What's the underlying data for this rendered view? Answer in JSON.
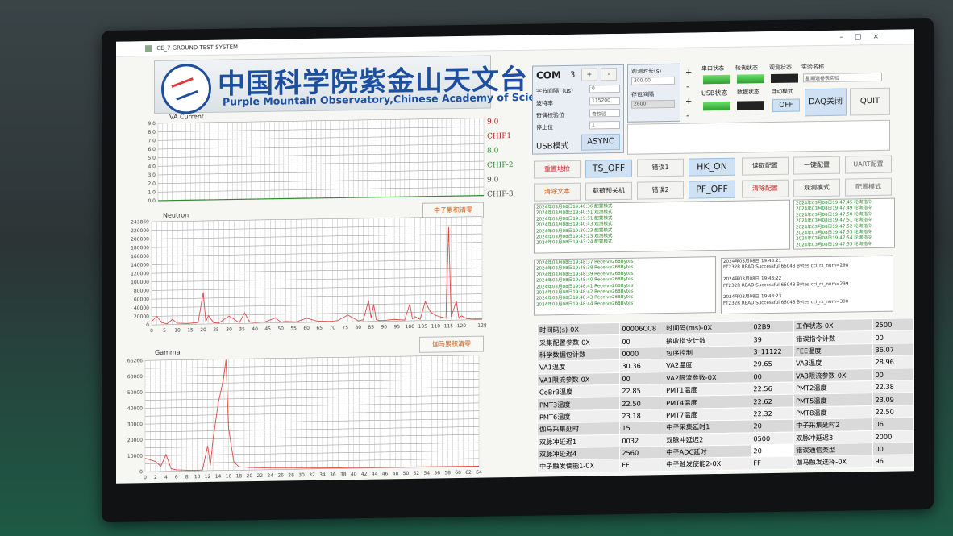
{
  "window": {
    "title": "CE_7 GROUND TEST SYSTEM"
  },
  "header": {
    "cn": "中国科学院紫金山天文台",
    "en": "Purple Mountain Observatory,Chinese Academy of Sciences"
  },
  "va_plot": {
    "label": "VA Current",
    "yticks": [
      "9.0",
      "8.0",
      "7.0",
      "6.0",
      "5.0",
      "4.0",
      "3.0",
      "2.0",
      "1.0",
      "0.0"
    ]
  },
  "legend": [
    {
      "value": "9.0",
      "color": "#c0281e"
    },
    {
      "name": "CHIP1",
      "color": "#c0281e"
    },
    {
      "value": "8.0",
      "color": "#2f8a2f"
    },
    {
      "name": "CHIP-2",
      "color": "#2f8a2f"
    },
    {
      "value": "9.0",
      "color": "#555555"
    },
    {
      "name": "CHIP-3",
      "color": "#555555"
    }
  ],
  "neutron_plot": {
    "label": "Neutron",
    "button": "中子累积清零",
    "yticks": [
      "243869",
      "220000",
      "200000",
      "180000",
      "160000",
      "140000",
      "120000",
      "100000",
      "80000",
      "60000",
      "40000",
      "20000",
      "0"
    ],
    "xticks": [
      "0",
      "5",
      "10",
      "15",
      "20",
      "25",
      "30",
      "35",
      "40",
      "45",
      "50",
      "55",
      "60",
      "65",
      "70",
      "75",
      "80",
      "85",
      "90",
      "95",
      "100",
      "105",
      "110",
      "115",
      "120",
      "128"
    ]
  },
  "gamma_plot": {
    "label": "Gamma",
    "button": "伽马累积清零",
    "yticks": [
      "66266",
      "60000",
      "50000",
      "40000",
      "30000",
      "20000",
      "10000",
      "0"
    ],
    "xticks": [
      "0",
      "2",
      "4",
      "6",
      "8",
      "10",
      "12",
      "14",
      "16",
      "18",
      "20",
      "22",
      "24",
      "26",
      "28",
      "30",
      "32",
      "34",
      "36",
      "38",
      "40",
      "42",
      "44",
      "46",
      "48",
      "50",
      "52",
      "54",
      "56",
      "58",
      "60",
      "62",
      "64"
    ]
  },
  "chart_data": [
    {
      "type": "line",
      "title": "VA Current",
      "series": [
        {
          "name": "CHIP1",
          "color": "#c0281e",
          "values": [
            0
          ]
        },
        {
          "name": "CHIP-2",
          "color": "#2f8a2f",
          "values": [
            0
          ]
        },
        {
          "name": "CHIP-3",
          "color": "#555555",
          "values": [
            0
          ]
        }
      ],
      "ylim": [
        0,
        9
      ]
    },
    {
      "type": "line",
      "title": "Neutron",
      "xlim": [
        0,
        128
      ],
      "ylim": [
        0,
        243869
      ],
      "x": [
        0,
        2,
        4,
        6,
        8,
        10,
        14,
        18,
        20,
        21,
        22,
        24,
        26,
        30,
        34,
        36,
        38,
        40,
        44,
        48,
        50,
        52,
        56,
        60,
        64,
        68,
        70,
        72,
        76,
        80,
        82,
        84,
        85,
        86,
        87,
        88,
        90,
        94,
        98,
        100,
        101,
        102,
        104,
        106,
        108,
        110,
        112,
        114,
        115,
        116,
        118,
        119,
        120,
        122,
        124,
        126,
        128
      ],
      "values": [
        8000,
        20000,
        5000,
        2000,
        12000,
        3000,
        2000,
        4000,
        75000,
        6000,
        20000,
        3000,
        2000,
        18000,
        2000,
        25000,
        3000,
        2000,
        3000,
        12000,
        2000,
        3000,
        2000,
        10000,
        3000,
        2000,
        2000,
        3000,
        16000,
        2000,
        4000,
        50000,
        8000,
        40000,
        4000,
        2000,
        2000,
        4000,
        2000,
        40000,
        5000,
        10000,
        3000,
        45000,
        20000,
        12000,
        8000,
        5000,
        220000,
        8000,
        45000,
        4000,
        10000,
        3000,
        2000,
        2000,
        2000
      ]
    },
    {
      "type": "line",
      "title": "Gamma",
      "xlim": [
        0,
        64
      ],
      "ylim": [
        0,
        66266
      ],
      "x": [
        0,
        1,
        2,
        3,
        4,
        5,
        6,
        8,
        10,
        11,
        12,
        12.5,
        13,
        14,
        15,
        15.5,
        16,
        17,
        18,
        20,
        24,
        28,
        32,
        36,
        40,
        44,
        48,
        52,
        56,
        60,
        64
      ],
      "values": [
        8000,
        7000,
        6000,
        3000,
        10000,
        1500,
        800,
        500,
        400,
        500,
        15000,
        3000,
        18000,
        40000,
        54000,
        66000,
        25000,
        5000,
        2000,
        1500,
        1000,
        800,
        600,
        500,
        500,
        400,
        300,
        300,
        200,
        200,
        100
      ]
    }
  ],
  "com": {
    "label": "COM",
    "port": "3",
    "plus": "+",
    "minus": "-",
    "byte_interval_label": "字节间隔（us）",
    "byte_interval_value": "0",
    "baud_label": "波特率",
    "baud_value": "115200",
    "parity_label": "奇偶校验位",
    "parity_value": "奇校验",
    "stop_label": "停止位",
    "stop_value": "1",
    "usb_mode_label": "USB模式",
    "async_label": "ASYNC"
  },
  "observe": {
    "duration_label": "观测时长(s)",
    "duration_value": "300.00",
    "interval_label": "存包间隔",
    "interval_value": "2600",
    "plus": "+",
    "minus": "-"
  },
  "status": {
    "serial_label": "串口状态",
    "polling_label": "轮询状态",
    "obs_label": "观测状态",
    "exp_label": "实验名称",
    "exp_value": "星期选卷表实验",
    "usb_label": "USB状态",
    "data_label": "数据状态",
    "auto_label": "自动模式",
    "auto_value": "OFF"
  },
  "actions": {
    "daq": "DAQ关闭",
    "quit": "QUIT"
  },
  "buttons": {
    "b1": "重置地检",
    "b2": "TS_OFF",
    "b3": "错误1",
    "b4": "HK_ON",
    "b5": "读取配置",
    "b6": "一键配置",
    "b7": "UART配置",
    "b8": "清除文本",
    "b9": "载荷预关机",
    "b10": "错误2",
    "b11": "PF_OFF",
    "b12": "清除配置",
    "b13": "观测模式",
    "b14": "配置模式"
  },
  "logs": {
    "config": [
      "2024年03月08日19:40:36  配置模式",
      "2024年03月08日19:40:51  观测模式",
      "2024年03月08日19:29:51  配置模式",
      "2024年03月08日19:40:43  观测模式",
      "2024年03月08日19:30:23  配置模式",
      "2024年03月08日19:43:23  观测模式",
      "2024年03月08日19:43:24  配置模式"
    ],
    "polling": [
      "2024年03月08日19:47:45  轮询指令",
      "2024年03月08日19:47:49  轮询指令",
      "2024年03月08日19:47:50  轮询指令",
      "2024年03月08日19:47:51  轮询指令",
      "2024年03月08日19:47:52  轮询指令",
      "2024年03月08日19:47:53  轮询指令",
      "2024年03月08日19:47:54  轮询指令",
      "2024年03月08日19:47:55  轮询指令"
    ],
    "receive": [
      "2024年03月08日19:48:37  Receive268Bytes",
      "2024年03月08日19:48:38  Receive268Bytes",
      "2024年03月08日19:48:39  Receive268Bytes",
      "2024年03月08日19:48:40  Receive268Bytes",
      "2024年03月08日19:48:41  Receive268Bytes",
      "2024年03月08日19:48:42  Receive268Bytes",
      "2024年03月08日19:48:43  Receive268Bytes",
      "2024年03月08日19:48:44  Receive268Bytes"
    ],
    "ft232": [
      "2024年03月08日  19:43:21",
      "FT232R READ Successful  66048 Bytes cci_rx_num=298",
      "",
      "2024年03月08日  19:43:22",
      "FT232R READ Successful  66048 Bytes cci_rx_num=299",
      "",
      "2024年03月08日  19:43:23",
      "FT232R READ Successful  66048 Bytes cci_rx_num=300"
    ]
  },
  "table": [
    [
      "时间码(s)-0X",
      "00006CC8",
      "时间码(ms)-0X",
      "02B9",
      "工作状态-0X",
      "2500"
    ],
    [
      "采集配置参数-0X",
      "00",
      "接收指令计数",
      "39",
      "错误指令计数",
      "00"
    ],
    [
      "科学数据包计数",
      "0000",
      "包序控制",
      "3_11122",
      "FEE温度",
      "36.07"
    ],
    [
      "VA1温度",
      "30.36",
      "VA2温度",
      "29.65",
      "VA3温度",
      "28.96"
    ],
    [
      "VA1限流参数-0X",
      "00",
      "VA2限流参数-0X",
      "00",
      "VA3限流参数-0X",
      "00"
    ],
    [
      "CeBr3温度",
      "22.85",
      "PMT1温度",
      "22.56",
      "PMT2温度",
      "22.38"
    ],
    [
      "PMT3温度",
      "22.50",
      "PMT4温度",
      "22.62",
      "PMT5温度",
      "23.09"
    ],
    [
      "PMT6温度",
      "23.18",
      "PMT7温度",
      "22.32",
      "PMT8温度",
      "22.50"
    ],
    [
      "伽马采集延时",
      "15",
      "中子采集延时1",
      "20",
      "中子采集延时2",
      "06"
    ],
    [
      "双脉冲延迟1",
      "0032",
      "双脉冲延迟2",
      "0500",
      "双脉冲延迟3",
      "2000"
    ],
    [
      "双脉冲延迟4",
      "2560",
      "中子ADC延时",
      "20",
      "错误通信类型",
      "00"
    ],
    [
      "中子触发使能1-0X",
      "FF",
      "中子触发使能2-0X",
      "FF",
      "伽马触发选择-0X",
      "96"
    ]
  ]
}
